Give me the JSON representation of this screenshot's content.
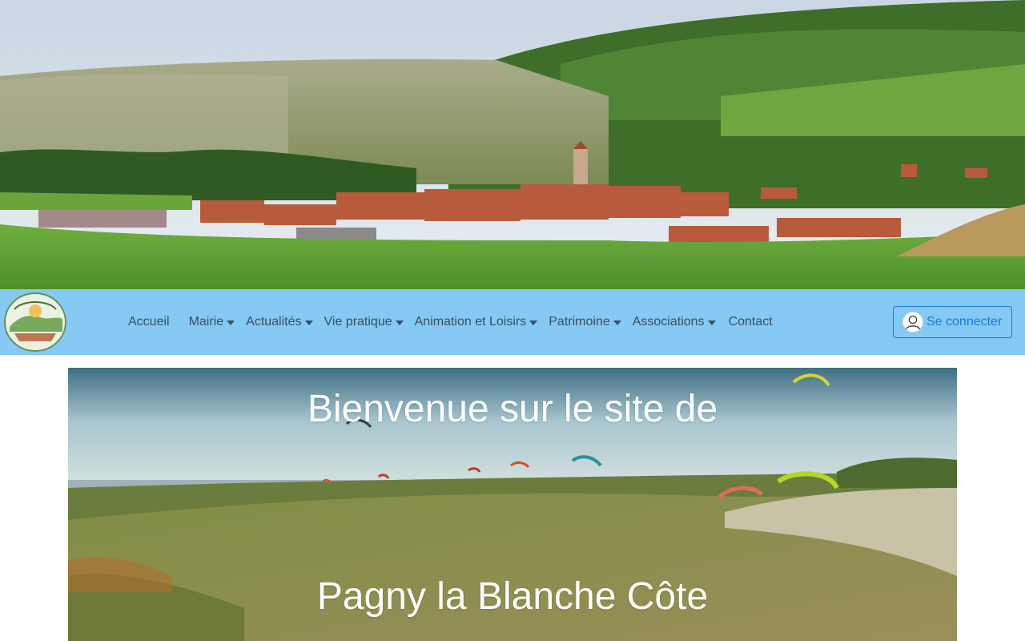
{
  "banner": {
    "image": "village-landscape-banner"
  },
  "header": {
    "logo": "pagny-la-blanche-cote-logo",
    "nav": [
      {
        "label": "Accueil",
        "dropdown": false
      },
      {
        "label": "Mairie",
        "dropdown": true
      },
      {
        "label": "Actualités",
        "dropdown": true
      },
      {
        "label": "Vie pratique",
        "dropdown": true
      },
      {
        "label": "Animation et Loisirs",
        "dropdown": true
      },
      {
        "label": "Patrimoine",
        "dropdown": true
      },
      {
        "label": "Associations",
        "dropdown": true
      },
      {
        "label": "Contact",
        "dropdown": false
      }
    ],
    "login_label": "Se connecter",
    "colors": {
      "nav_bg": "#85c9f4",
      "nav_text": "#3d4e5e",
      "login": "#1a7bd6"
    }
  },
  "hero": {
    "line1": "Bienvenue sur le site de",
    "line2": "Pagny la Blanche Côte",
    "image": "paragliders-over-hillside"
  }
}
